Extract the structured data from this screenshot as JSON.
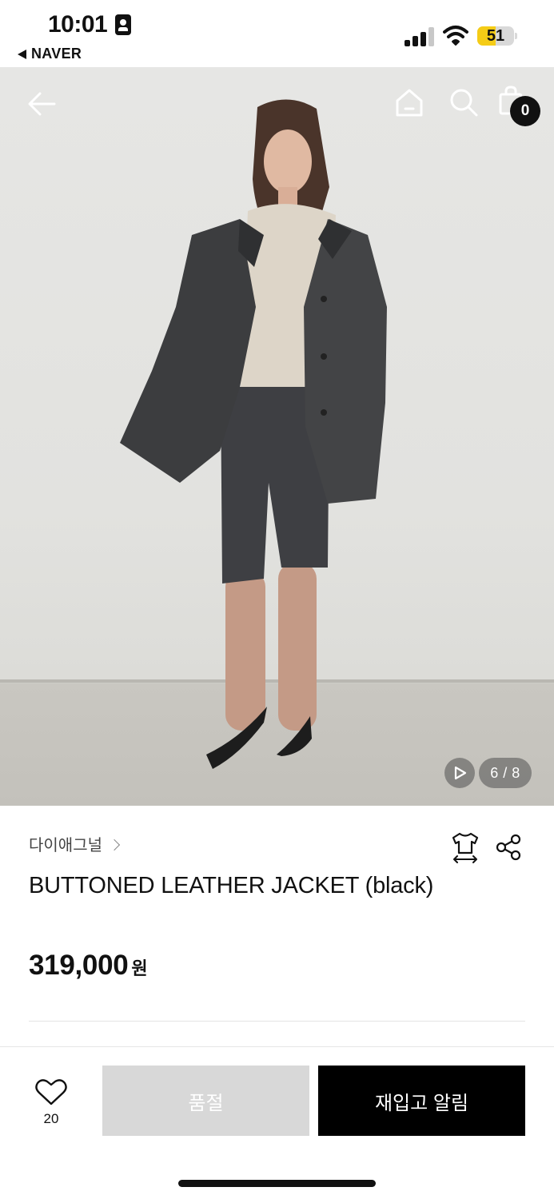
{
  "status_bar": {
    "time": "10:01",
    "back_app": "NAVER",
    "battery_percent": 51,
    "battery_label": "51",
    "battery_color": "#f5cc16",
    "signal_bars_active": 3,
    "signal_bars_total": 4
  },
  "header": {
    "cart_count": "0",
    "icons": [
      "arrow-left-icon",
      "home-icon",
      "search-icon",
      "shopping-bag-icon"
    ]
  },
  "gallery": {
    "counter": "6 / 8",
    "current": 6,
    "total": 8,
    "play_icon": "play-icon"
  },
  "product": {
    "brand": "다이애그널",
    "title": "BUTTONED LEATHER JACKET (black)",
    "price": "319,000",
    "currency": "원",
    "size_icon": "tshirt-size-icon",
    "share_icon": "share-icon"
  },
  "bottom_bar": {
    "like_count": "20",
    "like_icon": "heart-icon",
    "soldout_label": "품절",
    "restock_label": "재입고 알림"
  }
}
